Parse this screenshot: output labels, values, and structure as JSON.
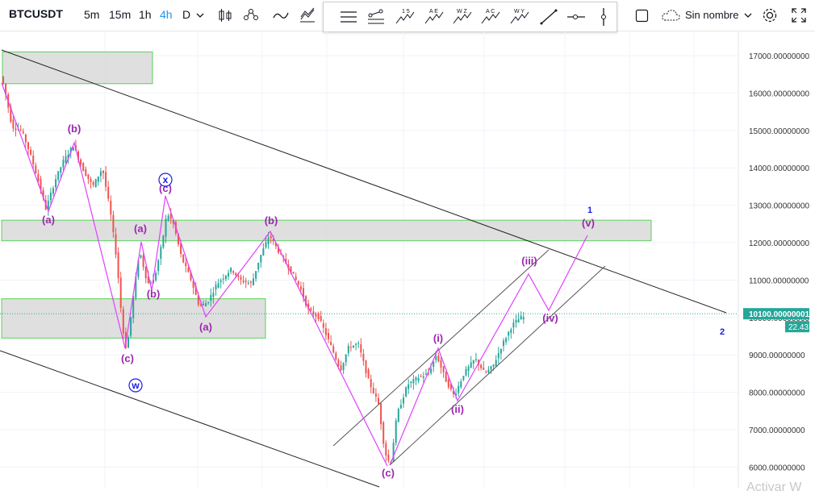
{
  "toolbar": {
    "symbol": "BTCUSDT",
    "intervals": [
      "5m",
      "15m",
      "1h",
      "4h",
      "D"
    ],
    "active_interval": "4h",
    "name_label": "Sin nombre",
    "draw_tool_labels": [
      "1 5",
      "A E",
      "W Z",
      "A C",
      "W Y"
    ]
  },
  "colors": {
    "up": "#26a69a",
    "down": "#ef5350",
    "wave": "#e040fb",
    "wave_label": "#9c27b0",
    "zone_border": "#5ad15a",
    "zone_fill": "#d9d9d9",
    "trend": "#222222",
    "degree_label": "#1a1ae6",
    "price_tag": "#26a69a"
  },
  "chart_data": {
    "type": "candlestick",
    "y_axis": {
      "ticks": [
        "17000.00000000",
        "16000.00000000",
        "15000.00000000",
        "14000.00000000",
        "13000.00000000",
        "12000.00000000",
        "11000.00000000",
        "10000.00000000",
        "9000.00000000",
        "8000.00000000",
        "7000.00000000",
        "6000.00000000"
      ],
      "range": [
        5400,
        17300
      ]
    },
    "last_price_label": "10100.00000001",
    "countdown_label": "22.43",
    "wave_labels": [
      "(b)",
      "(a)",
      "(c)",
      "(a)",
      "(b)",
      "(c)",
      "(a)",
      "(b)",
      "(c)",
      "(i)",
      "(ii)",
      "(iii)",
      "(iv)",
      "(v)"
    ],
    "circled_labels": [
      "x",
      "w"
    ],
    "degree_labels": [
      "1",
      "2"
    ],
    "zones": [
      {
        "price_top": 17100,
        "price_bottom": 16250
      },
      {
        "price_top": 12600,
        "price_bottom": 12050
      },
      {
        "price_top": 10500,
        "price_bottom": 9450
      }
    ]
  },
  "watermark": "Activar W"
}
